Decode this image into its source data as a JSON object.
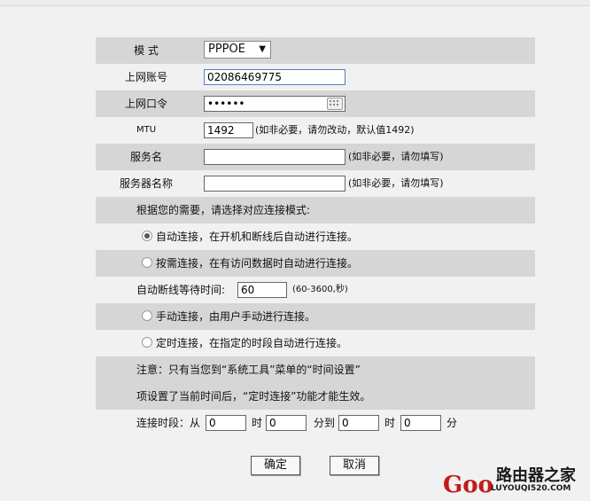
{
  "form": {
    "mode_label": "模 式",
    "mode_value": "PPPOE",
    "account_label": "上网账号",
    "account_value": "02086469775",
    "password_label": "上网口令",
    "password_value": "••••••",
    "mtu_label": "MTU",
    "mtu_value": "1492",
    "mtu_hint": "(如非必要，请勿改动，默认值1492)",
    "service_label": "服务名",
    "service_value": "",
    "service_hint": "(如非必要，请勿填写)",
    "server_label": "服务器名称",
    "server_value": "",
    "server_hint": "(如非必要，请勿填写)",
    "mode_prompt": "根据您的需要，请选择对应连接模式:",
    "options": [
      {
        "label": "自动连接，在开机和断线后自动进行连接。",
        "selected": true
      },
      {
        "label": "按需连接，在有访问数据时自动进行连接。",
        "selected": false
      },
      {
        "label": "手动连接，由用户手动进行连接。",
        "selected": false
      },
      {
        "label": "定时连接，在指定的时段自动进行连接。",
        "selected": false
      }
    ],
    "idle_label": "自动断线等待时间:",
    "idle_value": "60",
    "idle_hint": "(60-3600,秒)",
    "note_line1": "注意：只有当您到“系统工具”菜单的“时间设置”",
    "note_line2": "项设置了当前时间后，“定时连接”功能才能生效。",
    "period_label": "连接时段：从",
    "start_hour": "0",
    "hour_unit": "时",
    "start_min": "0",
    "to_label": "分到",
    "end_hour": "0",
    "end_hour_unit": "时",
    "end_min": "0",
    "min_unit": "分"
  },
  "buttons": {
    "ok": "确定",
    "cancel": "取消"
  },
  "watermark": {
    "brand_cn": "路由器之家",
    "brand_url": "LUYOUQI520.COM",
    "brand_g": "Goo"
  }
}
